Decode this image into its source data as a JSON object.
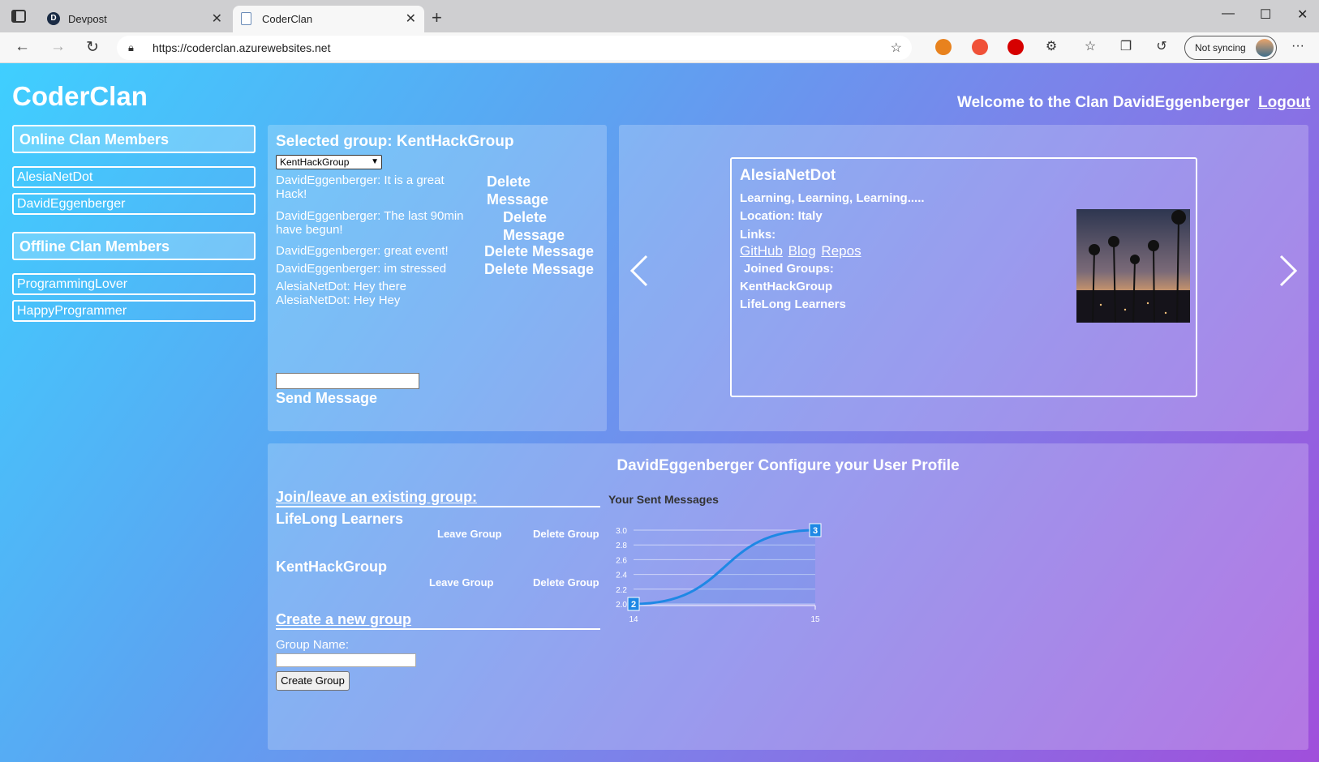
{
  "browser": {
    "tabs": [
      {
        "title": "Devpost",
        "favicon": "D"
      },
      {
        "title": "CoderClan",
        "favicon": "page-icon"
      }
    ],
    "url": "https://coderclan.azurewebsites.net",
    "sync_label": "Not syncing"
  },
  "header": {
    "brand": "CoderClan",
    "welcome": "Welcome to the Clan DavidEggenberger",
    "logout": "Logout"
  },
  "sidebar": {
    "online_title": "Online Clan Members",
    "online": [
      "AlesiaNetDot",
      "DavidEggenberger"
    ],
    "offline_title": "Offline Clan Members",
    "offline": [
      "ProgrammingLover",
      "HappyProgrammer"
    ]
  },
  "chat": {
    "title": "Selected group: KentHackGroup",
    "selected_group": "KentHackGroup",
    "messages": [
      {
        "text": "DavidEggenberger: It is a great Hack!",
        "delete": "Delete Message"
      },
      {
        "text": "DavidEggenberger: The last 90min have begun!",
        "delete": "Delete Message"
      },
      {
        "text": "DavidEggenberger: great event!",
        "delete": "Delete Message"
      },
      {
        "text": "DavidEggenberger: im stressed",
        "delete": "Delete Message"
      },
      {
        "text": "AlesiaNetDot: Hey there"
      },
      {
        "text": "AlesiaNetDot: Hey Hey"
      }
    ],
    "send_label": "Send Message"
  },
  "member_card": {
    "name": "AlesiaNetDot",
    "bio": "Learning, Learning, Learning.....",
    "location": "Location: Italy",
    "links_label": "Links:",
    "links": [
      "GitHub",
      "Blog",
      "Repos"
    ],
    "joined_label": "Joined Groups:",
    "groups": [
      "KentHackGroup",
      "LifeLong Learners"
    ]
  },
  "profile": {
    "title": "DavidEggenberger Configure your User Profile",
    "join_leave_title": "Join/leave an existing group:",
    "groups": [
      {
        "name": "LifeLong Learners",
        "leave": "Leave Group",
        "delete": "Delete Group"
      },
      {
        "name": "KentHackGroup",
        "leave": "Leave Group",
        "delete": "Delete Group"
      }
    ],
    "create_title": "Create a new group",
    "group_name_label": "Group Name:",
    "create_button": "Create Group"
  },
  "chart_data": {
    "type": "line",
    "title": "Your Sent Messages",
    "x": [
      14,
      15
    ],
    "values": [
      2,
      3
    ],
    "data_labels": [
      "2",
      "3"
    ],
    "ylim": [
      2.0,
      3.0
    ],
    "yticks": [
      "2.0",
      "2.2",
      "2.4",
      "2.6",
      "2.8",
      "3.0"
    ],
    "xticks": [
      "14",
      "15"
    ],
    "color": "#1e88e5",
    "grid": true
  }
}
